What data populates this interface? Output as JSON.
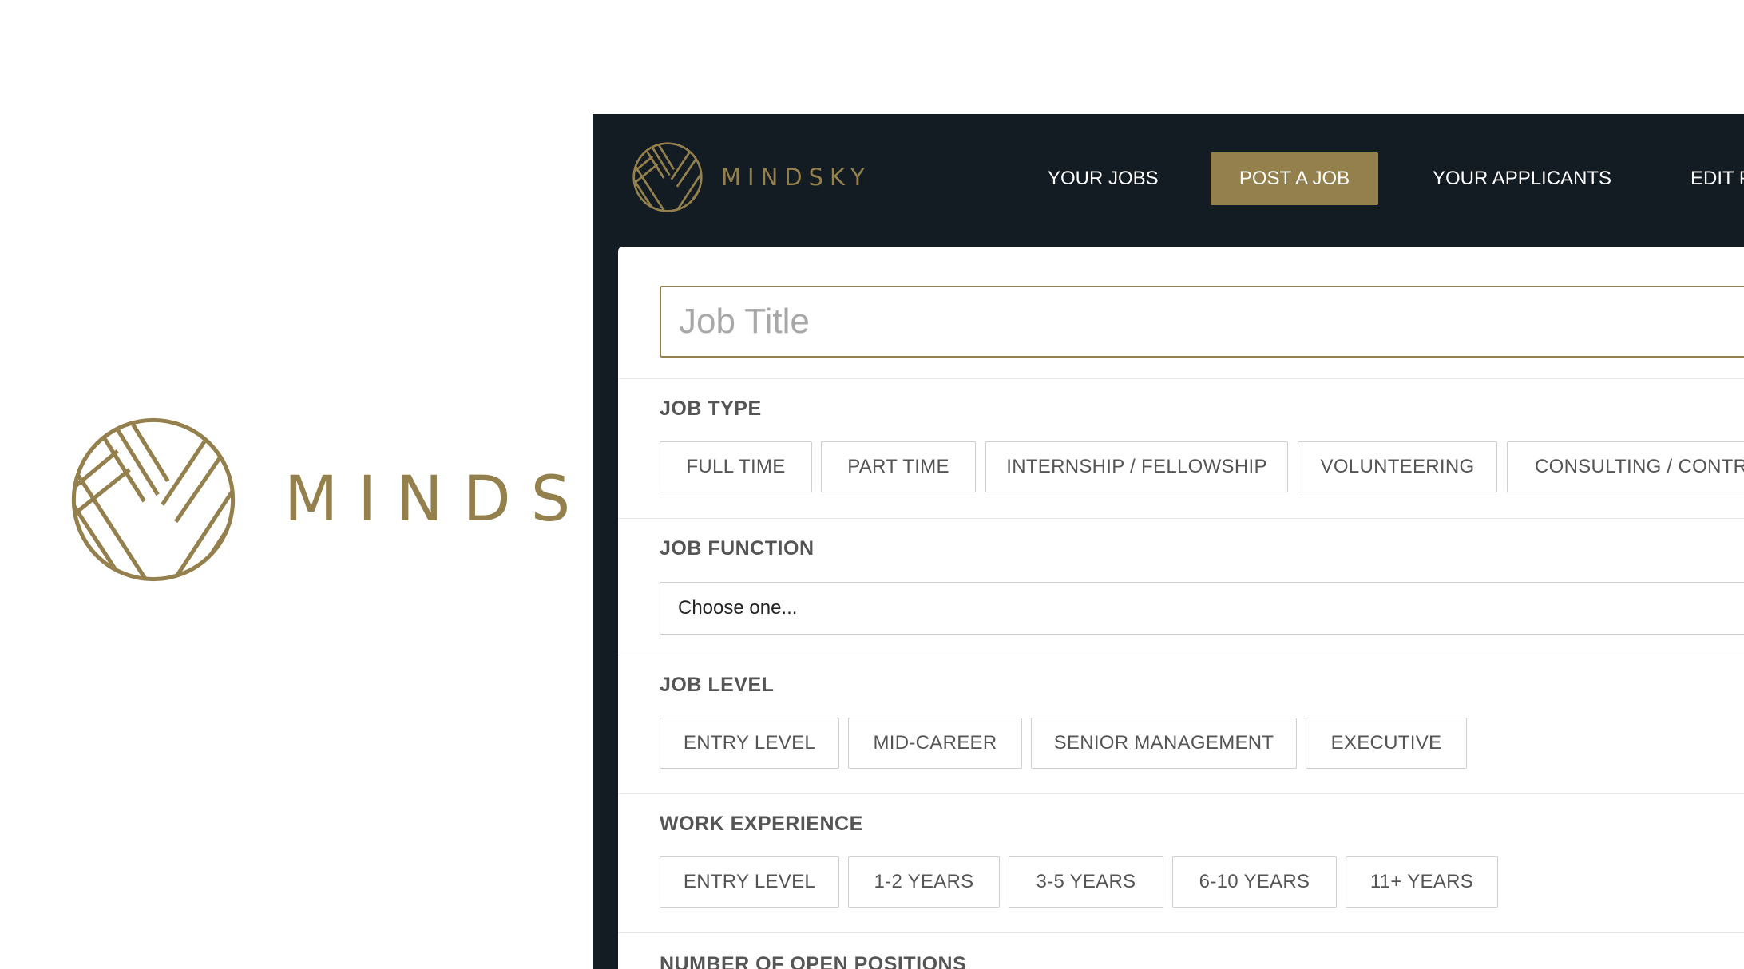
{
  "brand": {
    "name": "MINDSKY"
  },
  "colors": {
    "gold": "#94804d",
    "navy": "#131b23",
    "border": "#cfcfcf",
    "label": "#555555"
  },
  "nav": {
    "items": [
      {
        "label": "YOUR JOBS",
        "active": false
      },
      {
        "label": "POST A JOB",
        "active": true
      },
      {
        "label": "YOUR APPLICANTS",
        "active": false
      },
      {
        "label": "EDIT P",
        "active": false
      }
    ]
  },
  "form": {
    "job_title": {
      "placeholder": "Job Title",
      "value": ""
    },
    "job_type": {
      "label": "JOB TYPE",
      "options": [
        "FULL TIME",
        "PART TIME",
        "INTERNSHIP / FELLOWSHIP",
        "VOLUNTEERING",
        "CONSULTING / CONTRA"
      ]
    },
    "job_function": {
      "label": "JOB FUNCTION",
      "selected": "Choose one..."
    },
    "job_level": {
      "label": "JOB LEVEL",
      "options": [
        "ENTRY LEVEL",
        "MID-CAREER",
        "SENIOR MANAGEMENT",
        "EXECUTIVE"
      ]
    },
    "work_experience": {
      "label": "WORK EXPERIENCE",
      "options": [
        "ENTRY LEVEL",
        "1-2 YEARS",
        "3-5 YEARS",
        "6-10 YEARS",
        "11+ YEARS"
      ]
    },
    "open_positions": {
      "label": "NUMBER OF OPEN POSITIONS"
    }
  }
}
